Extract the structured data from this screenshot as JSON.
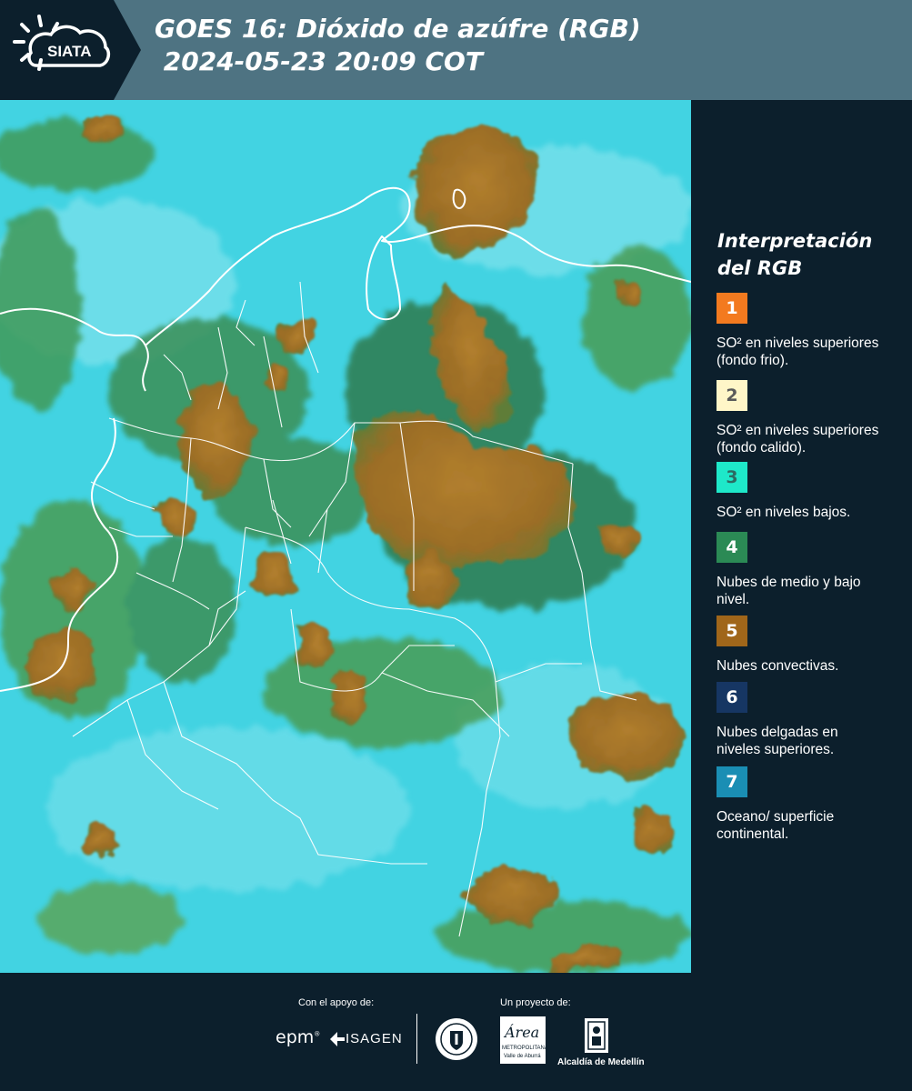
{
  "header": {
    "logo_text": "SIATA",
    "title_line1": "GOES 16: Dióxido de azúfre (RGB)",
    "title_line2": " 2024-05-23 20:09 COT"
  },
  "legend": {
    "title": "Interpretación del RGB",
    "items": [
      {
        "num": "1",
        "color": "#f37a1f",
        "numColor": "#ffffff",
        "text": "SO² en niveles superiores (fondo frio)."
      },
      {
        "num": "2",
        "color": "#fff6c8",
        "numColor": "#5a5a5a",
        "text": "SO² en niveles superiores (fondo calido)."
      },
      {
        "num": "3",
        "color": "#1ee8c9",
        "numColor": "#2d6a62",
        "text": "SO² en niveles bajos."
      },
      {
        "num": "4",
        "color": "#2b8a55",
        "numColor": "#ffffff",
        "text": "Nubes de medio y bajo nivel."
      },
      {
        "num": "5",
        "color": "#a0661a",
        "numColor": "#ffffff",
        "text": "Nubes convectivas."
      },
      {
        "num": "6",
        "color": "#163663",
        "numColor": "#ffffff",
        "text": "Nubes delgadas en niveles superiores."
      },
      {
        "num": "7",
        "color": "#1a8eb4",
        "numColor": "#ffffff",
        "text": "Oceano/ superficie continental."
      }
    ]
  },
  "footer": {
    "support_label": "Con el apoyo de:",
    "project_label": "Un proyecto de:",
    "epm": "epm",
    "isagen": "ISAGEN",
    "area_metro": "Área",
    "area_metro_sub": "METROPOLITANA",
    "area_metro_sub2": "Valle de Aburrá",
    "alcaldia": "Alcaldía de Medellín"
  },
  "colors": {
    "header_bg": "#4e7382",
    "page_bg": "#0c1f2c",
    "ocean": "#3fd2e0",
    "cloud_brown": "#a8772a",
    "cloud_green": "#3d9a58"
  }
}
